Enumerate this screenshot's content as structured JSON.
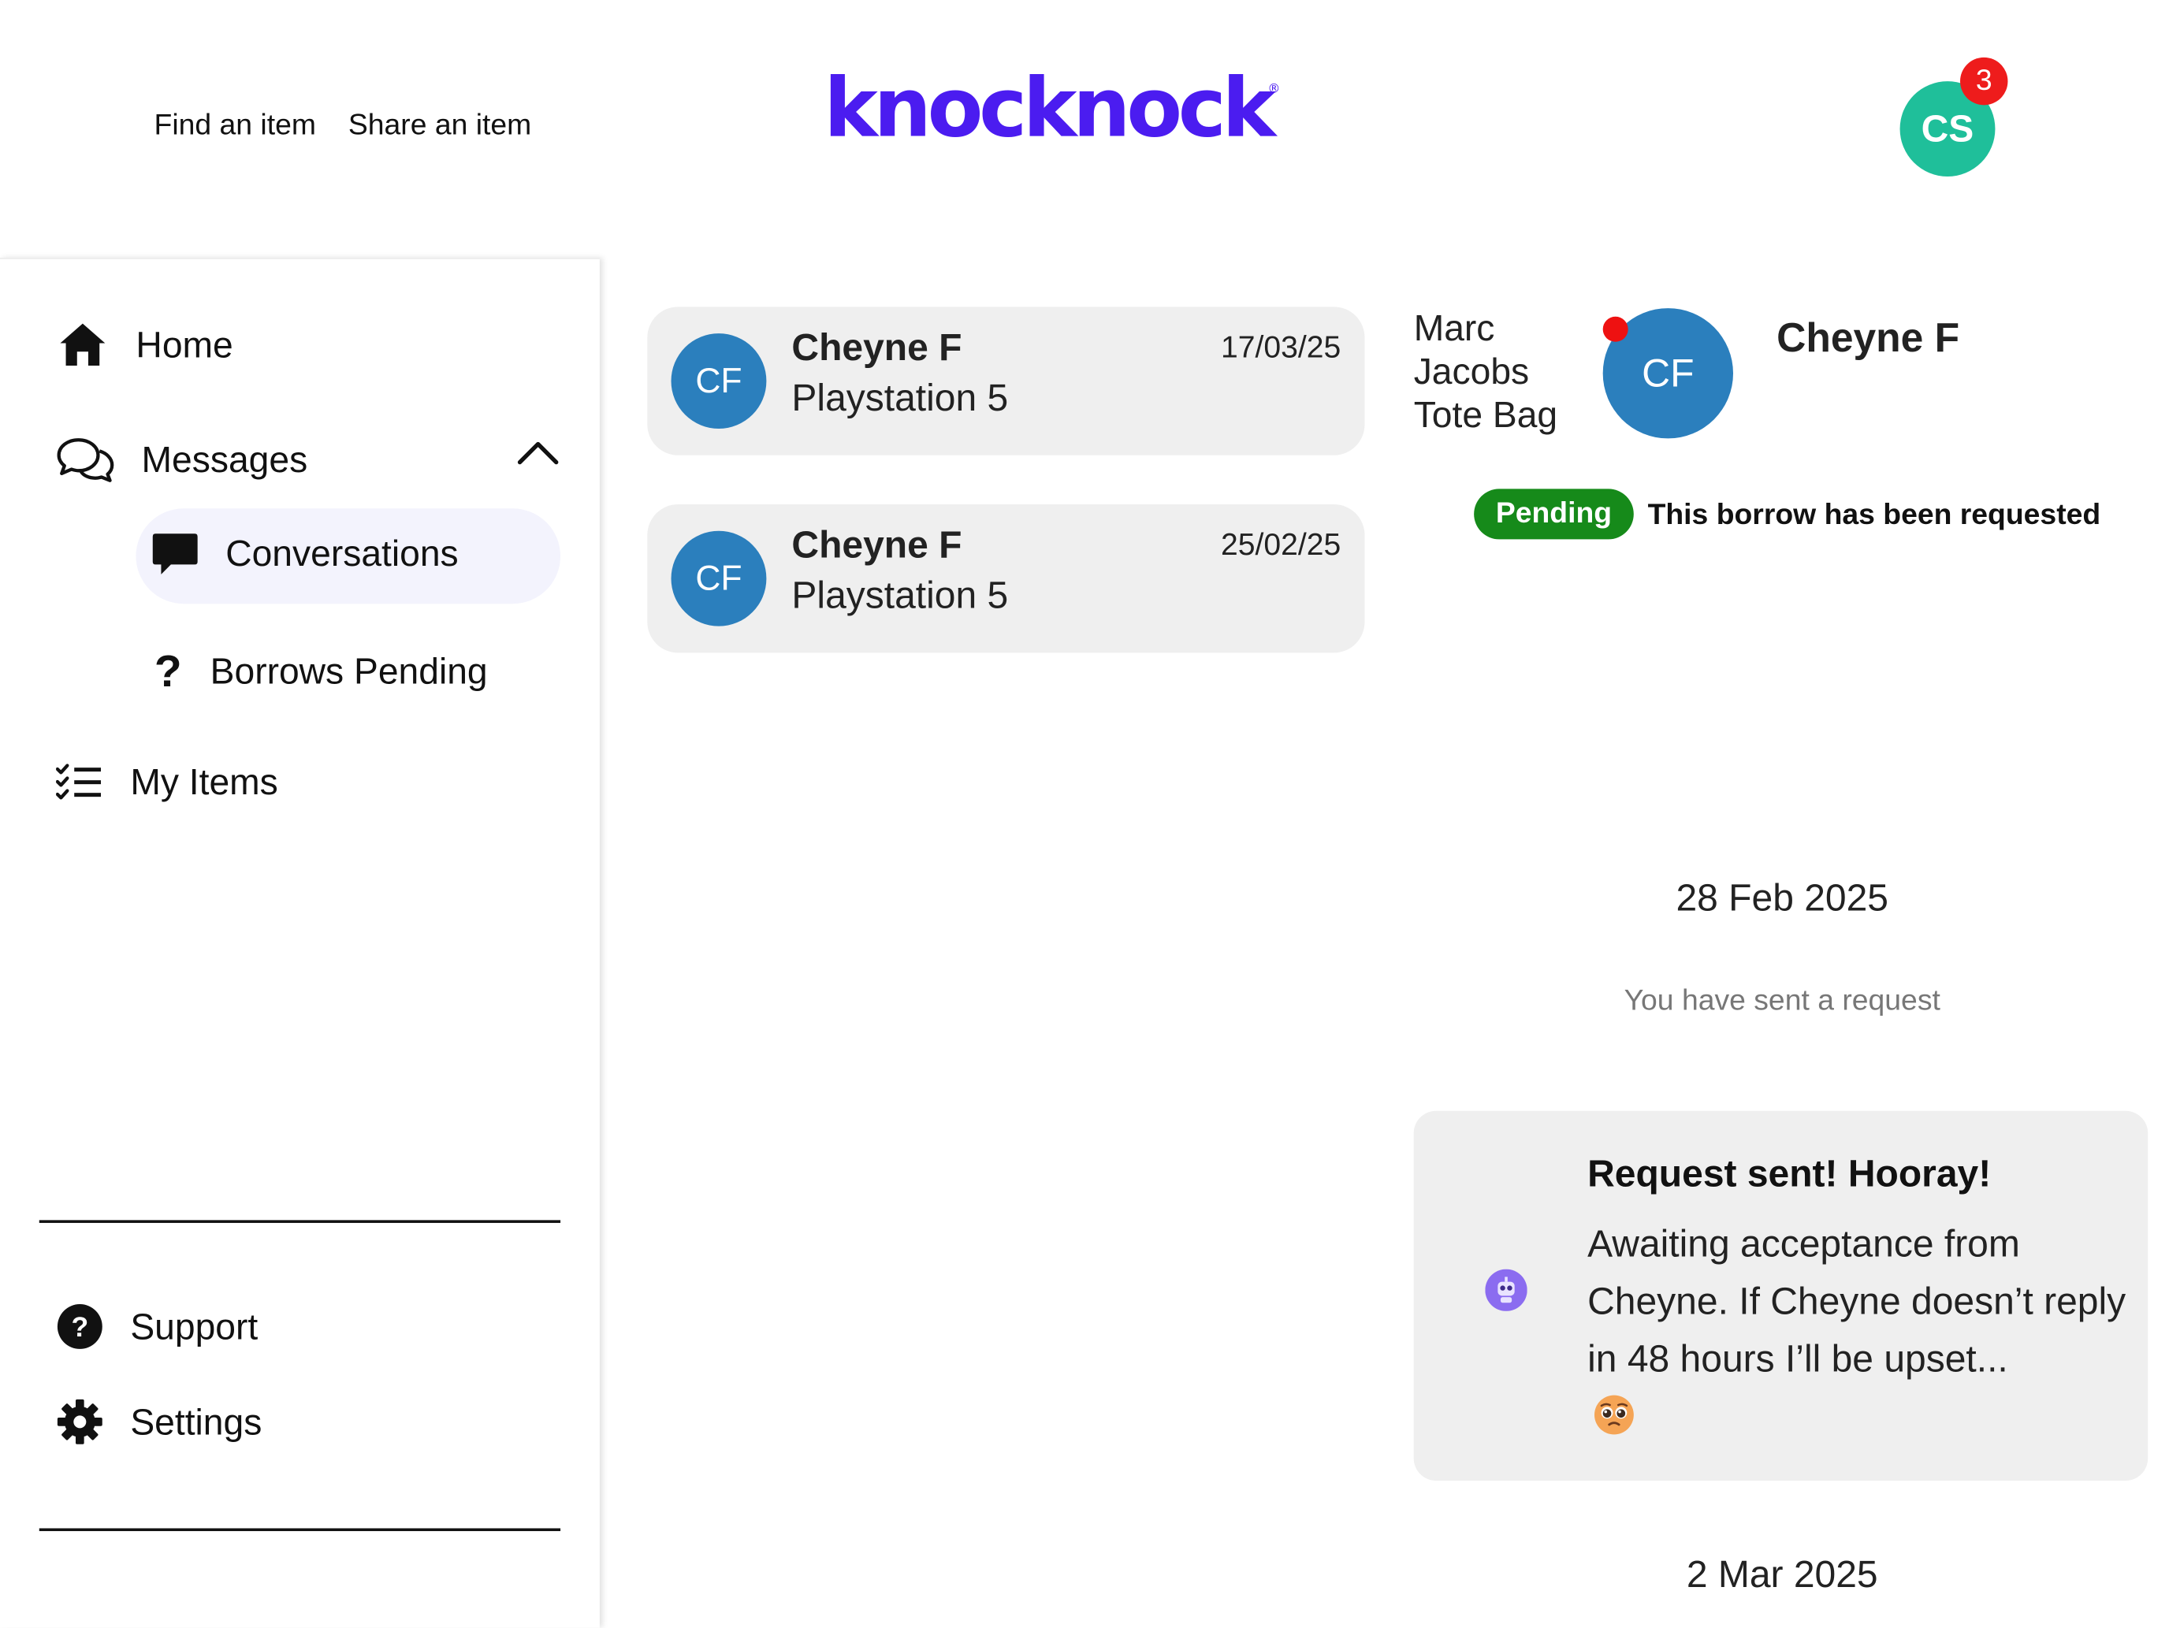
{
  "header": {
    "nav": [
      "Find an item",
      "Share an item"
    ],
    "logo_text": "knocknock",
    "logo_registered": "®",
    "user_initials": "CS",
    "notification_count": "3"
  },
  "sidebar": {
    "home": "Home",
    "messages": "Messages",
    "conversations": "Conversations",
    "borrows_pending": "Borrows Pending",
    "my_items": "My Items",
    "support": "Support",
    "settings": "Settings"
  },
  "conversations": [
    {
      "initials": "CF",
      "name": "Cheyne F",
      "item": "Playstation 5",
      "date": "17/03/25"
    },
    {
      "initials": "CF",
      "name": "Cheyne F",
      "item": "Playstation 5",
      "date": "25/02/25"
    }
  ],
  "chat": {
    "item_title": "Marc Jacobs Tote Bag",
    "partner_initials": "CF",
    "partner_name": "Cheyne F",
    "status_badge": "Pending",
    "status_text": "This borrow has been requested",
    "date_1": "28 Feb 2025",
    "system_message": "You have sent a request",
    "bot_title": "Request sent! Hooray!",
    "bot_body": "Awaiting acceptance from Cheyne. If Cheyne doesn’t reply in 48 hours I’ll be upset...",
    "date_2": "2 Mar 2025"
  },
  "colors": {
    "brand": "#4b1cf0",
    "user_avatar": "#1fbf9a",
    "notification": "#ee1c1c",
    "contact_avatar": "#2b7fbd",
    "pending": "#168a1a",
    "online_dot": "#ee1111",
    "bot": "#8b6cf0"
  }
}
